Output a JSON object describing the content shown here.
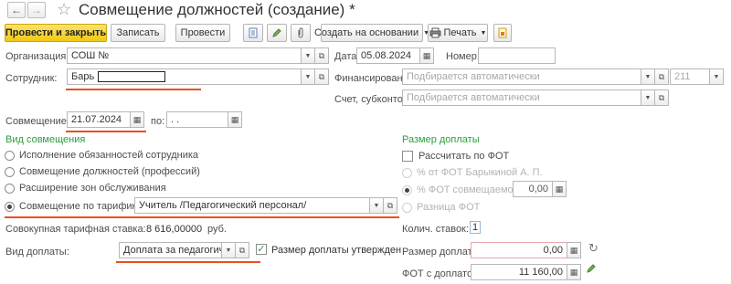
{
  "window": {
    "title": "Совмещение должностей (создание) *"
  },
  "toolbar": {
    "post_close": "Провести и закрыть",
    "save": "Записать",
    "post": "Провести",
    "create_based": "Создать на основании",
    "print": "Печать"
  },
  "header": {
    "org_label": "Организация:",
    "org_value": "СОШ №",
    "date_label": "Дата:",
    "date_value": "05.08.2024",
    "number_label": "Номер:",
    "number_value": "",
    "employee_label": "Сотрудник:",
    "employee_value": "Барь",
    "financing_label": "Финансирование:",
    "financing_placeholder": "Подбирается автоматически",
    "financing_code": "211",
    "account_label": "Счет, субконто:",
    "account_placeholder": "Подбирается автоматически"
  },
  "period": {
    "from_label": "Совмещение с:",
    "from_value": "21.07.2024",
    "to_label": "по:",
    "to_value": " .  .     "
  },
  "combination": {
    "section_title": "Вид совмещения",
    "options": [
      "Исполнение обязанностей сотрудника",
      "Совмещение должностей (профессий)",
      "Расширение зон обслуживания",
      "Совмещение по тарификации"
    ],
    "selected_index": 3,
    "tariff_position": "Учитель /Педагогический персонал/",
    "total_rate_label": "Совокупная тарифная ставка:",
    "total_rate_value": "8 616,00000",
    "total_rate_unit": "руб.",
    "payment_type_label": "Вид доплаты:",
    "payment_type_value": "Доплата за педагогическ",
    "payment_approved_label": "Размер доплаты утвержден",
    "payment_approved": true
  },
  "payment": {
    "section_title": "Размер доплаты",
    "calc_by_fot_label": "Рассчитать по ФОТ",
    "calc_by_fot": false,
    "options": [
      "% от ФОТ Барыкиной А. П.",
      "% ФОТ совмещаемого",
      "Разница ФОТ"
    ],
    "selected_index": 1,
    "percent_value": "0,00",
    "rates_count_label": "Колич. ставок:",
    "rates_count_value": "1",
    "amount_label": "Размер доплаты:",
    "amount_value": "0,00",
    "fot_with_payment_label": "ФОТ с доплатой:",
    "fot_with_payment_value": "11 160,00"
  },
  "colors": {
    "accent_yellow": "#f1c915",
    "section_green": "#2c9e3c",
    "underline_red": "#e8501e"
  }
}
